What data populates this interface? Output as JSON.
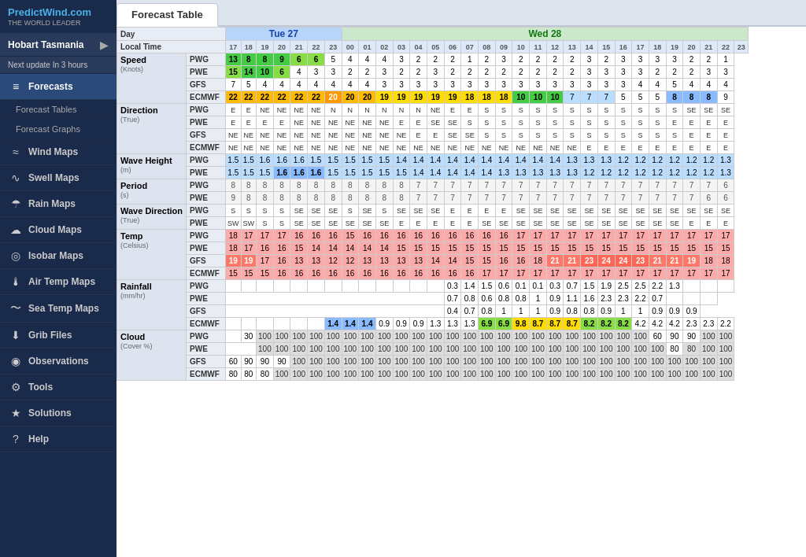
{
  "sidebar": {
    "logo": "PredictWind.com",
    "logo_sub": "THE WORLD LEADER",
    "location": "Hobart Tasmania",
    "next_update": "Next update In 3 hours",
    "items": [
      {
        "id": "forecasts",
        "label": "Forecasts",
        "icon": "≡",
        "active": true
      },
      {
        "id": "forecast-tables",
        "label": "Forecast Tables",
        "icon": "▦",
        "sub": true,
        "active": false
      },
      {
        "id": "forecast-graphs",
        "label": "Forecast Graphs",
        "icon": "↗",
        "sub": true,
        "active": false
      },
      {
        "id": "wind-maps",
        "label": "Wind Maps",
        "icon": "≈",
        "active": false
      },
      {
        "id": "swell-maps",
        "label": "Swell Maps",
        "icon": "∿",
        "active": false
      },
      {
        "id": "rain-maps",
        "label": "Rain Maps",
        "icon": "☂",
        "active": false
      },
      {
        "id": "cloud-maps",
        "label": "Cloud Maps",
        "icon": "☁",
        "active": false
      },
      {
        "id": "isobar-maps",
        "label": "Isobar Maps",
        "icon": "◎",
        "active": false
      },
      {
        "id": "air-temp-maps",
        "label": "Air Temp Maps",
        "icon": "🌡",
        "active": false
      },
      {
        "id": "sea-temp-maps",
        "label": "Sea Temp Maps",
        "icon": "〜",
        "active": false
      },
      {
        "id": "grib-files",
        "label": "Grib Files",
        "icon": "⬇",
        "active": false
      },
      {
        "id": "observations",
        "label": "Observations",
        "icon": "◉",
        "active": false
      },
      {
        "id": "tools",
        "label": "Tools",
        "icon": "⚙",
        "active": false
      },
      {
        "id": "solutions",
        "label": "Solutions",
        "icon": "★",
        "active": false
      },
      {
        "id": "help",
        "label": "Help",
        "icon": "?",
        "active": false
      }
    ]
  },
  "tabs": [
    {
      "id": "forecast-table",
      "label": "Forecast Table",
      "active": true
    }
  ],
  "table": {
    "day_headers": [
      {
        "label": "Tue 27",
        "span": 7,
        "class": "day-header"
      },
      {
        "label": "Wed 28",
        "span": 24,
        "class": "day-header-wed"
      }
    ],
    "times_tue": [
      "17",
      "18",
      "19",
      "20",
      "21",
      "22",
      "23"
    ],
    "times_wed": [
      "00",
      "01",
      "02",
      "03",
      "04",
      "05",
      "06",
      "07",
      "08",
      "09",
      "10",
      "11",
      "12",
      "13",
      "14",
      "15",
      "16",
      "17",
      "18",
      "19",
      "20",
      "21",
      "22",
      "23"
    ]
  }
}
